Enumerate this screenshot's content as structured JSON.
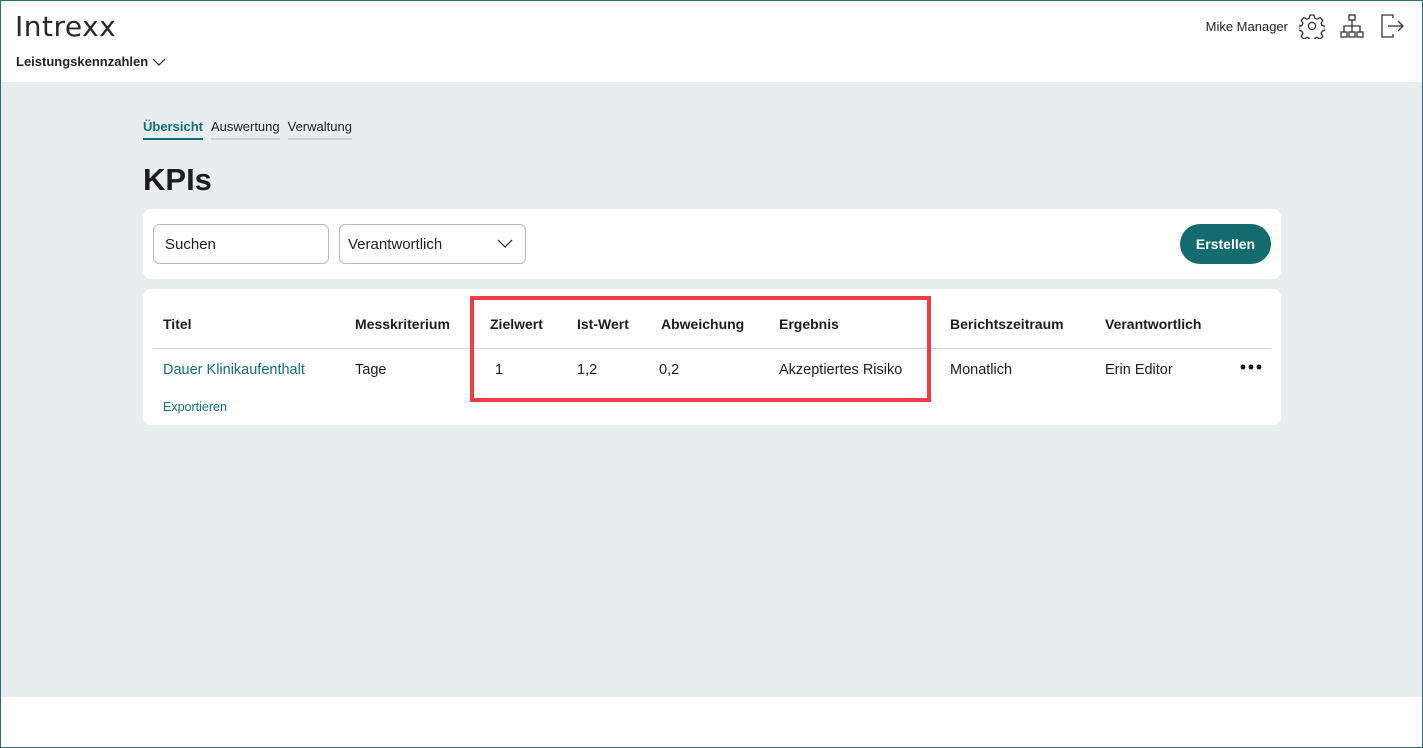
{
  "header": {
    "logo": "Intrexx",
    "app_name": "Leistungskennzahlen",
    "user_name": "Mike Manager",
    "icons": [
      "gear-icon",
      "sitemap-icon",
      "logout-icon"
    ]
  },
  "tabs": [
    {
      "label": "Übersicht",
      "active": true
    },
    {
      "label": "Auswertung",
      "active": false
    },
    {
      "label": "Verwaltung",
      "active": false
    }
  ],
  "page": {
    "title": "KPIs"
  },
  "toolbar": {
    "search_placeholder": "Suchen",
    "filter_value": "Verantwortlich",
    "create_label": "Erstellen"
  },
  "table": {
    "columns": [
      "Titel",
      "Messkriterium",
      "Zielwert",
      "Ist-Wert",
      "Abweichung",
      "Ergebnis",
      "Berichtszeitraum",
      "Verantwortlich"
    ],
    "rows": [
      {
        "titel": "Dauer Klinikaufenthalt",
        "messkriterium": "Tage",
        "zielwert": "1",
        "ist_wert": "1,2",
        "abweichung": "0,2",
        "ergebnis": "Akzeptiertes Risiko",
        "berichtszeitraum": "Monatlich",
        "verantwortlich": "Erin Editor"
      }
    ],
    "export_label": "Exportieren"
  },
  "colors": {
    "accent": "#146b6e",
    "link": "#166f73",
    "background": "#e8edf0",
    "highlight": "#ee3d48"
  }
}
